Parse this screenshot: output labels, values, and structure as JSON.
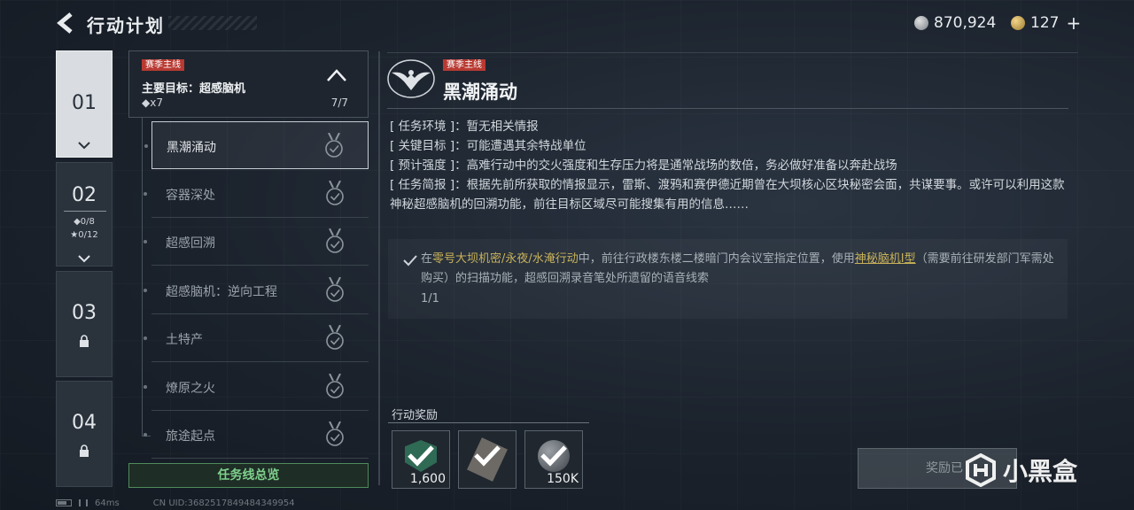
{
  "header": {
    "title": "行动计划",
    "currency_primary": "870,924",
    "currency_secondary": "127",
    "plus_label": "+"
  },
  "chapters": [
    {
      "num": "01",
      "state": "active"
    },
    {
      "num": "02",
      "state": "expanded",
      "diamonds": "◆0/8",
      "stars": "★0/12"
    },
    {
      "num": "03",
      "state": "locked"
    },
    {
      "num": "04",
      "state": "locked"
    }
  ],
  "questline": {
    "tag": "赛季主线",
    "title": "主要目标：超感脑机",
    "count": "◆x7",
    "progress": "7/7",
    "items": [
      {
        "label": "黑潮涌动",
        "active": true
      },
      {
        "label": "容器深处"
      },
      {
        "label": "超感回溯"
      },
      {
        "label": "超感脑机：逆向工程"
      },
      {
        "label": "土特产"
      },
      {
        "label": "燎原之火"
      },
      {
        "label": "旅途起点"
      }
    ],
    "overview_button": "任务线总览"
  },
  "detail": {
    "tag": "赛季主线",
    "title": "黑潮涌动",
    "env_key": "[ 任务环境 ]",
    "env_val": "：暂无相关情报",
    "target_key": "[ 关键目标 ]",
    "target_val": "：可能遭遇其余特战单位",
    "intensity_key": "[ 预计强度 ]",
    "intensity_val": "：高难行动中的交火强度和生存压力将是通常战场的数倍，务必做好准备以奔赴战场",
    "brief_key": "[ 任务简报 ]",
    "brief_val": "：根据先前所获取的情报显示，雷斯、渡鸦和赛伊德近期曾在大坝核心区块秘密会面，共谋要事。或许可以利用这款神秘超感脑机的回溯功能，前往目标区域尽可能搜集有用的信息……",
    "task": {
      "prefix": "在",
      "map": "零号大坝机密/永夜/水淹行动",
      "middle": "中，前往行政楼东楼二楼暗门内会议室指定位置，使用",
      "item": "神秘脑机Ⅰ型",
      "suffix": "（需要前往研发部门军需处购买）的扫描功能，超感回溯录音笔处所遗留的语音线索",
      "progress": "1/1"
    },
    "rewards_label": "行动奖励",
    "rewards": [
      {
        "qty": "1,600",
        "claimed": true
      },
      {
        "qty": "",
        "claimed": true
      },
      {
        "qty": "150K",
        "claimed": true
      }
    ],
    "claim_button": "奖励已"
  },
  "watermark": {
    "text": "小黑盒"
  },
  "statusbar": {
    "ping": "64ms",
    "uid": "CN UID:3682517849484349954"
  }
}
